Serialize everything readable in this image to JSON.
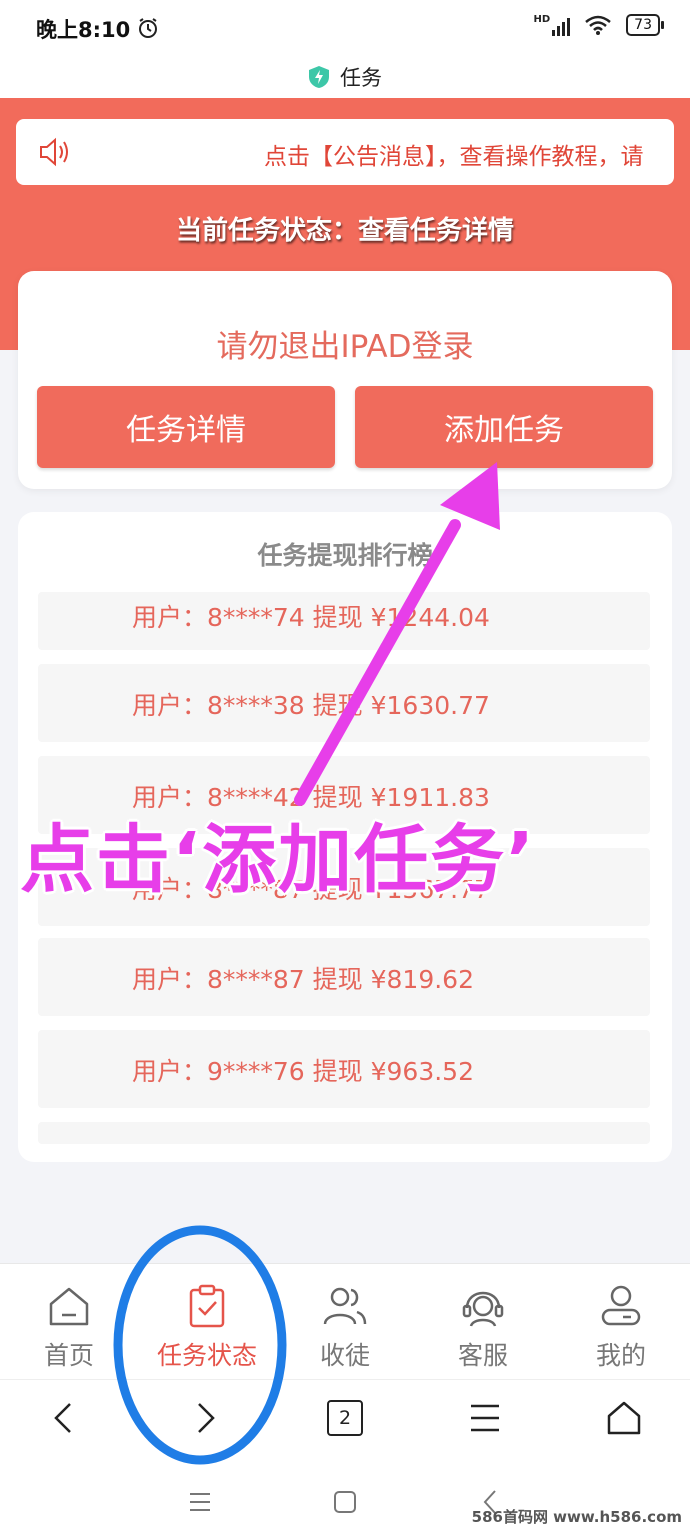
{
  "status_bar": {
    "time": "晚上8:10",
    "network": "HD",
    "battery": "73"
  },
  "title_bar": {
    "title": "任务"
  },
  "notice": {
    "text": "点击【公告消息】，查看操作教程，请"
  },
  "task_status": {
    "line": "当前任务状态：查看任务详情"
  },
  "card": {
    "title": "请勿退出IPAD登录",
    "detail_button": "任务详情",
    "add_button": "添加任务"
  },
  "ranking": {
    "title": "任务提现排行榜",
    "rows": [
      "用户：8****74 提现 ¥1244.04",
      "用户：8****38 提现 ¥1630.77",
      "用户：8****42 提现 ¥1911.83",
      "用户：8****87 提现 ¥1567.77",
      "用户：8****87 提现 ¥819.62",
      "用户：9****76 提现 ¥963.52"
    ]
  },
  "bottom_nav": {
    "items": [
      {
        "label": "首页",
        "icon": "home-icon"
      },
      {
        "label": "任务状态",
        "icon": "clipboard-check-icon",
        "active": true
      },
      {
        "label": "收徒",
        "icon": "users-icon"
      },
      {
        "label": "客服",
        "icon": "headset-icon"
      },
      {
        "label": "我的",
        "icon": "user-icon"
      }
    ]
  },
  "browser_bar": {
    "tab_count": "2"
  },
  "watermark": "586首码网 www.h586.com",
  "annotation": {
    "text": "点击‘添加任务’"
  },
  "colors": {
    "accent": "#f26b5b",
    "annotation": "#e73ee9",
    "circle": "#1f7de6"
  }
}
